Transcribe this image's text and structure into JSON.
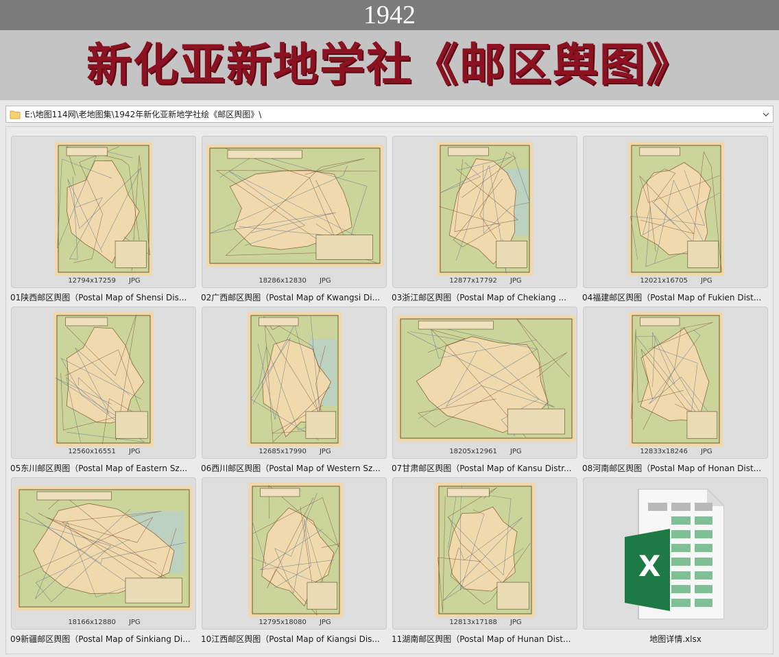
{
  "header": {
    "year": "1942",
    "title": "新化亚新地学社《邮区舆图》"
  },
  "address_bar": {
    "path": "E:\\地图114网\\老地图集\\1942年新化亚新地学社绘《邮区舆图》\\",
    "folder_icon": "folder-icon",
    "dropdown_icon": "chevron-down-icon"
  },
  "files": [
    {
      "name": "01陕西邮区舆图（Postal Map of Shensi Dis...",
      "dims": "12794x17259",
      "type": "JPG"
    },
    {
      "name": "02广西邮区舆图（Postal Map of Kwangsi Di...",
      "dims": "18286x12830",
      "type": "JPG"
    },
    {
      "name": "03浙江邮区舆图（Postal Map of Chekiang ...",
      "dims": "12877x17792",
      "type": "JPG"
    },
    {
      "name": "04福建邮区舆图（Postal Map of Fukien Dist...",
      "dims": "12021x16705",
      "type": "JPG"
    },
    {
      "name": "05东川邮区舆图（Postal Map of Eastern Sz...",
      "dims": "12560x16551",
      "type": "JPG"
    },
    {
      "name": "06西川邮区舆图（Postal Map of Western Sz...",
      "dims": "12685x17990",
      "type": "JPG"
    },
    {
      "name": "07甘肃邮区舆图（Postal Map of Kansu Distr...",
      "dims": "18205x12961",
      "type": "JPG"
    },
    {
      "name": "08河南邮区舆图（Postal Map of Honan Dist...",
      "dims": "12833x18246",
      "type": "JPG"
    },
    {
      "name": "09新疆邮区舆图（Postal Map of Sinkiang Di...",
      "dims": "18166x12880",
      "type": "JPG"
    },
    {
      "name": "10江西邮区舆图（Postal Map of Kiangsi Dis...",
      "dims": "12795x18080",
      "type": "JPG"
    },
    {
      "name": "11湖南邮区舆图（Postal Map of Hunan Dist...",
      "dims": "12813x17188",
      "type": "JPG"
    }
  ],
  "xlsx": {
    "name": "地图详情.xlsx",
    "icon": "excel-icon",
    "letter": "X",
    "color": "#1e7a44"
  },
  "colors": {
    "map_paper": "#f2d8a8",
    "map_land": "#cbd59a",
    "map_water": "#b9cfc9",
    "title_red": "#8c1221"
  }
}
